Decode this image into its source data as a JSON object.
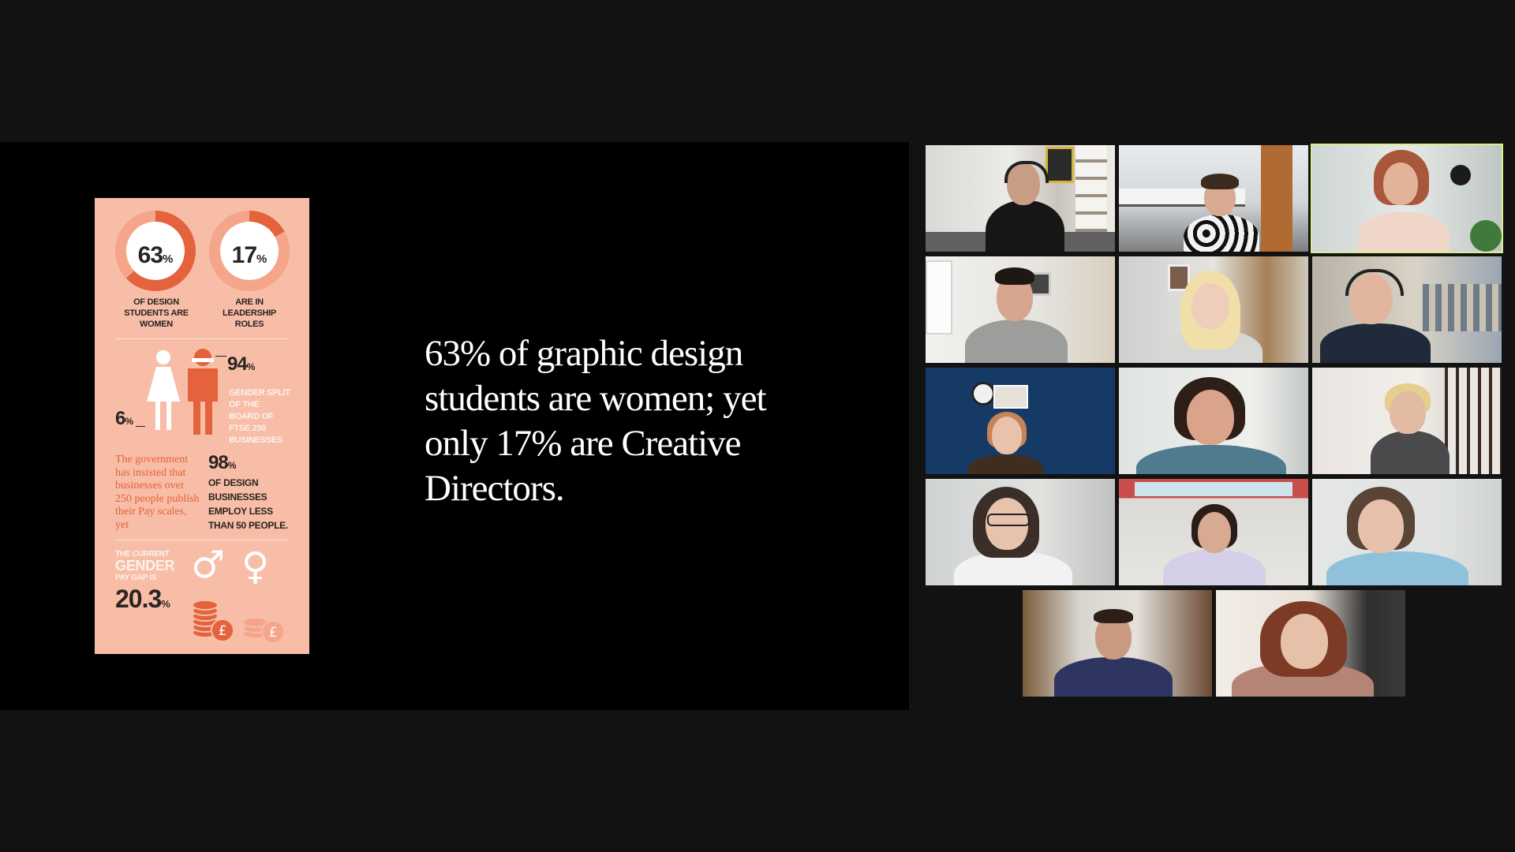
{
  "slide": {
    "headline": "63% of graphic design students are women; yet only 17% are Creative Directors.",
    "infographic": {
      "stat1_value": "63",
      "stat1_unit": "%",
      "stat1_caption": "OF DESIGN STUDENTS ARE WOMEN",
      "stat2_value": "17",
      "stat2_unit": "%",
      "stat2_caption": "ARE IN LEADERSHIP ROLES",
      "men_value": "94",
      "men_unit": "%",
      "women_value": "6",
      "women_unit": "%",
      "board_caption": "GENDER SPLIT OF THE BOARD OF FTSE 250 BUSINESSES",
      "government_text": "The government has insisted that businesses over 250 people publish their Pay scales, yet",
      "stat3_value": "98",
      "stat3_unit": "%",
      "stat3_caption": "OF DESIGN BUSINESSES EMPLOY LESS THAN 50 PEOPLE.",
      "paygap_label_1": "THE CURRENT",
      "paygap_label_2": "GENDER",
      "paygap_label_3": "PAY GAP IS",
      "paygap_value": "20.3",
      "paygap_unit": "%",
      "currency_symbol": "£",
      "male_symbol": "♂",
      "female_symbol": "♀",
      "colors": {
        "background": "#f7bda6",
        "accent": "#e4623c",
        "light_accent": "#f4a58a"
      },
      "ring1_fraction": 0.63,
      "ring2_fraction": 0.17
    }
  },
  "participants": [
    {
      "id": "p1",
      "icon": "participant-video",
      "active": false
    },
    {
      "id": "p2",
      "icon": "participant-video",
      "active": false
    },
    {
      "id": "p3",
      "icon": "participant-video",
      "active": true
    },
    {
      "id": "p4",
      "icon": "participant-video",
      "active": false
    },
    {
      "id": "p5",
      "icon": "participant-video",
      "active": false
    },
    {
      "id": "p6",
      "icon": "participant-video",
      "active": false
    },
    {
      "id": "p7",
      "icon": "participant-video",
      "active": false
    },
    {
      "id": "p8",
      "icon": "participant-video",
      "active": false
    },
    {
      "id": "p9",
      "icon": "participant-video",
      "active": false
    },
    {
      "id": "p10",
      "icon": "participant-video",
      "active": false
    },
    {
      "id": "p11",
      "icon": "participant-video",
      "active": false
    },
    {
      "id": "p12",
      "icon": "participant-video",
      "active": false
    },
    {
      "id": "p13",
      "icon": "participant-video",
      "active": false
    },
    {
      "id": "p14",
      "icon": "participant-video",
      "active": false
    }
  ],
  "colors": {
    "app_background": "#121212",
    "share_background": "#000000",
    "active_speaker": "#d9f08a"
  }
}
